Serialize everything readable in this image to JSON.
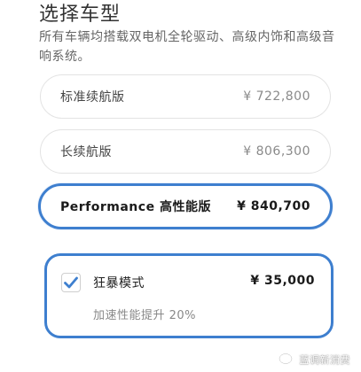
{
  "header": {
    "title": "选择车型",
    "subtitle": "所有车辆均搭载双电机全轮驱动、高级内饰和高级音响系统。"
  },
  "models": [
    {
      "label": "标准续航版",
      "price": "¥ 722,800",
      "selected": false
    },
    {
      "label": "长续航版",
      "price": "¥ 806,300",
      "selected": false
    },
    {
      "label": "Performance 高性能版",
      "price": "¥ 840,700",
      "selected": true
    }
  ],
  "addon": {
    "label": "狂暴模式",
    "price": "¥ 35,000",
    "description": "加速性能提升 20%",
    "checked": true,
    "check_icon": "checkmark-icon"
  },
  "watermark": {
    "text": "蓝调新消费",
    "icon": "wechat-logo-icon"
  },
  "colors": {
    "accent": "#3e7fcf",
    "border": "#e3e3e3",
    "muted_text": "#888888"
  }
}
